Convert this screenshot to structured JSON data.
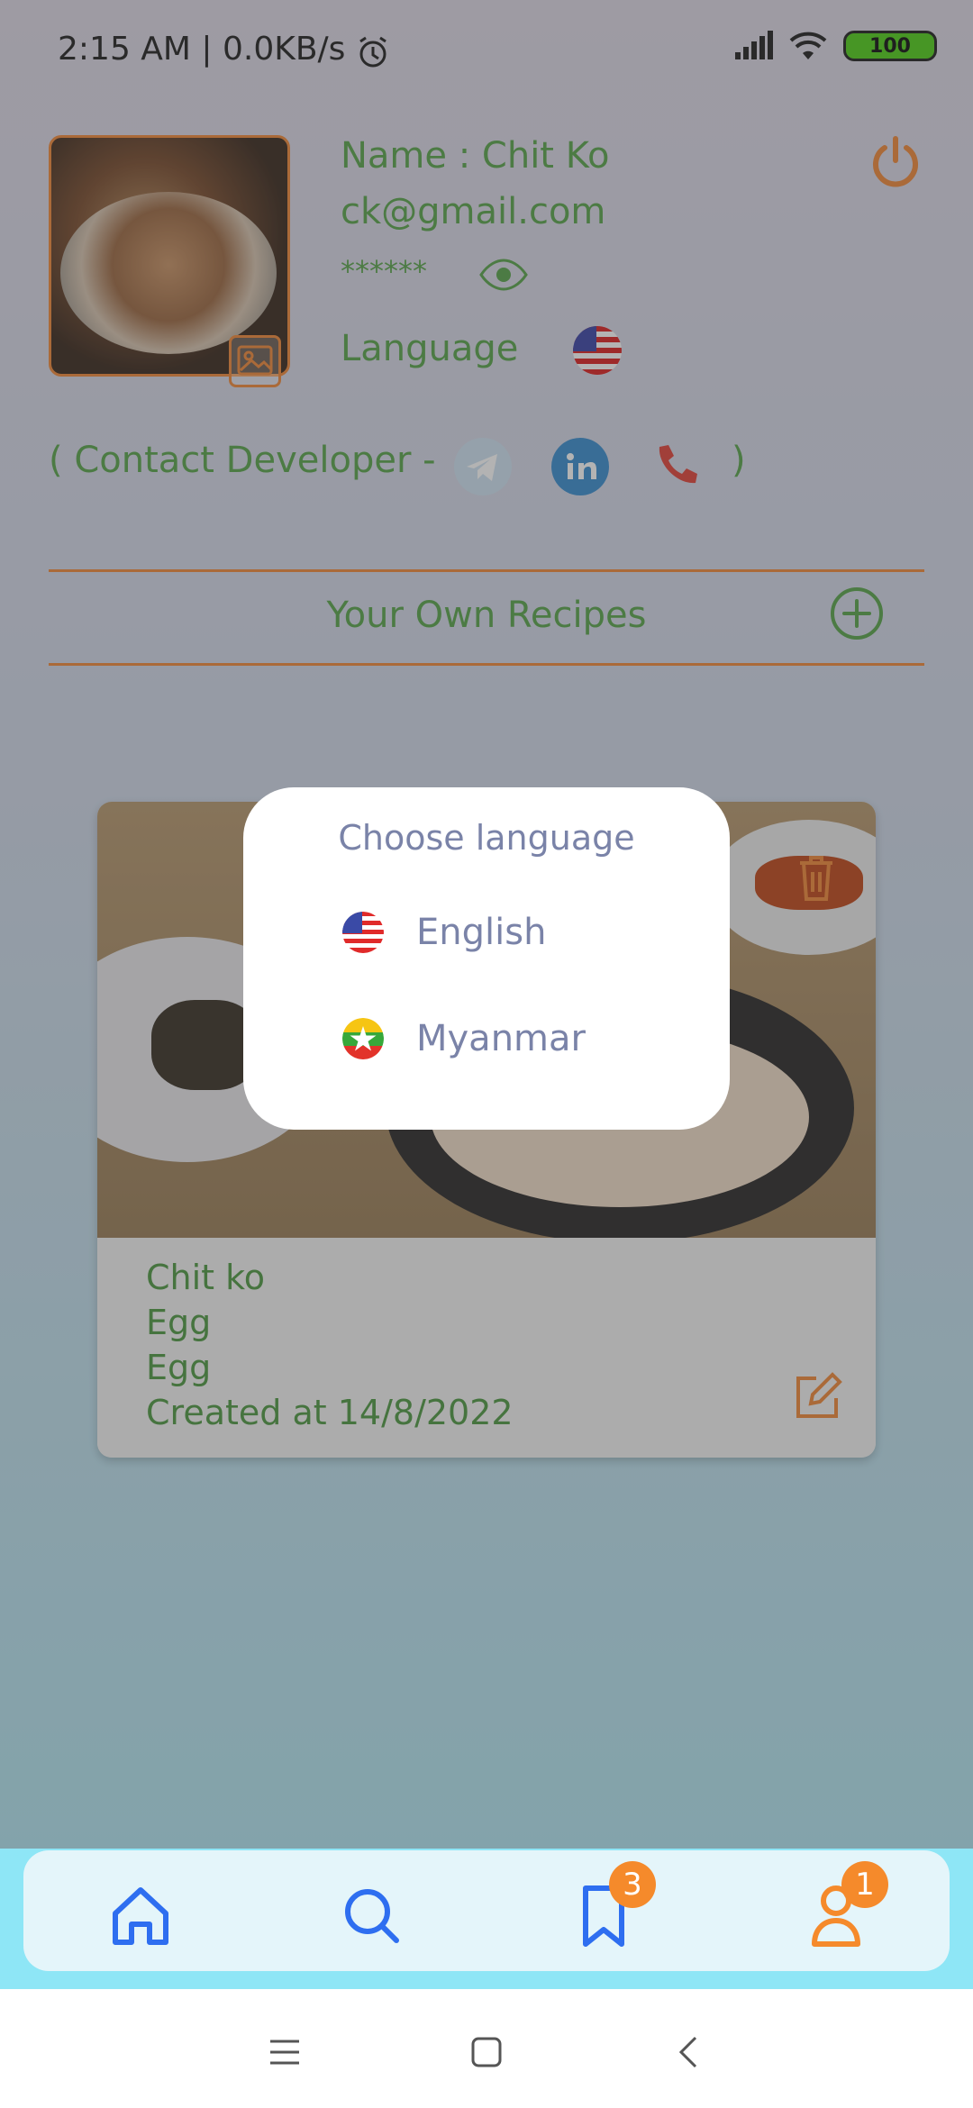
{
  "status_bar": {
    "time": "2:15  AM  |  0.0KB/s",
    "battery": "100"
  },
  "profile": {
    "name_line": "Name : Chit Ko",
    "email": "ck@gmail.com",
    "password_mask": "******",
    "language_label": "Language",
    "contact_open": "( Contact Developer -",
    "contact_close": ")"
  },
  "recipes": {
    "section_title": "Your Own Recipes",
    "items": [
      {
        "author": "Chit ko",
        "line2": "Egg",
        "line3": "Egg",
        "created": "Created at 14/8/2022"
      }
    ]
  },
  "dialog": {
    "title": "Choose language",
    "options": [
      {
        "label": "English",
        "flag": "us-flag-icon"
      },
      {
        "label": "Myanmar",
        "flag": "myanmar-flag-icon"
      }
    ]
  },
  "bottom_nav": {
    "items": [
      {
        "name": "home",
        "icon": "home-icon"
      },
      {
        "name": "search",
        "icon": "search-icon"
      },
      {
        "name": "bookmarks",
        "icon": "bookmark-icon",
        "badge": "3"
      },
      {
        "name": "profile",
        "icon": "person-icon",
        "badge": "1"
      }
    ]
  },
  "colors": {
    "accent_green": "#5aa54c",
    "accent_orange": "#f08a3a",
    "dialog_text": "#7a83a8",
    "badge": "#f58a2b"
  }
}
